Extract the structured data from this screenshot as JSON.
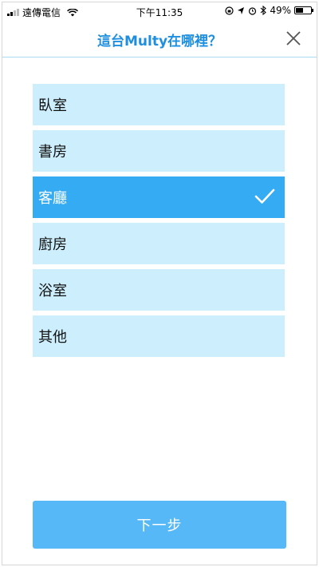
{
  "status_bar": {
    "carrier": "遠傳電信",
    "time": "下午11:35",
    "battery": "49%",
    "battery_level": 0.49
  },
  "header": {
    "title": "這台Multy在哪裡？",
    "close_icon": "close-icon"
  },
  "options": [
    {
      "label": "臥室",
      "selected": false
    },
    {
      "label": "書房",
      "selected": false
    },
    {
      "label": "客廳",
      "selected": true
    },
    {
      "label": "廚房",
      "selected": false
    },
    {
      "label": "浴室",
      "selected": false
    },
    {
      "label": "其他",
      "selected": false
    }
  ],
  "next_button": {
    "label": "下一步"
  },
  "colors": {
    "accent": "#1e8fe0",
    "option_bg": "#cdeefd",
    "option_selected_bg": "#35abf3",
    "button_bg": "#56b8f6"
  }
}
